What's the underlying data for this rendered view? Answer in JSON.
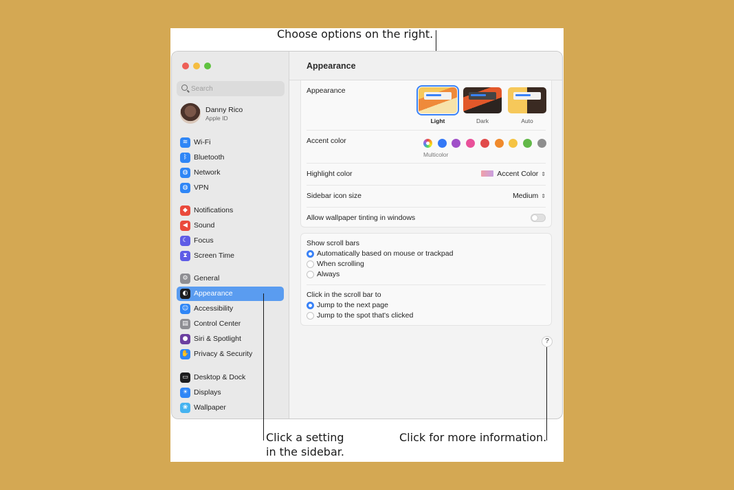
{
  "callouts": {
    "top": "Choose options on the right.",
    "left_line1": "Click a setting",
    "left_line2": "in the sidebar.",
    "right": "Click for more information."
  },
  "sidebar": {
    "search_placeholder": "Search",
    "account": {
      "name": "Danny Rico",
      "subtitle": "Apple ID"
    },
    "items": [
      {
        "label": "Wi-Fi",
        "icon": "wifi-icon",
        "color": "#2f86f6"
      },
      {
        "label": "Bluetooth",
        "icon": "bluetooth-icon",
        "color": "#2f86f6"
      },
      {
        "label": "Network",
        "icon": "globe-icon",
        "color": "#2f86f6"
      },
      {
        "label": "VPN",
        "icon": "vpn-globe-icon",
        "color": "#2f86f6"
      },
      {
        "label": "Notifications",
        "icon": "bell-icon",
        "color": "#ea4a3c"
      },
      {
        "label": "Sound",
        "icon": "speaker-icon",
        "color": "#ea4a3c"
      },
      {
        "label": "Focus",
        "icon": "moon-icon",
        "color": "#5e5ce6"
      },
      {
        "label": "Screen Time",
        "icon": "hourglass-icon",
        "color": "#5e5ce6"
      },
      {
        "label": "General",
        "icon": "gear-icon",
        "color": "#8e8e93"
      },
      {
        "label": "Appearance",
        "icon": "appearance-icon",
        "color": "#1c1c1e",
        "selected": true
      },
      {
        "label": "Accessibility",
        "icon": "accessibility-icon",
        "color": "#2f86f6"
      },
      {
        "label": "Control Center",
        "icon": "control-center-icon",
        "color": "#8e8e93"
      },
      {
        "label": "Siri & Spotlight",
        "icon": "siri-icon",
        "color": "#6b3fa0"
      },
      {
        "label": "Privacy & Security",
        "icon": "hand-icon",
        "color": "#2f86f6"
      },
      {
        "label": "Desktop & Dock",
        "icon": "dock-icon",
        "color": "#1c1c1e"
      },
      {
        "label": "Displays",
        "icon": "sun-icon",
        "color": "#2f86f6"
      },
      {
        "label": "Wallpaper",
        "icon": "flower-icon",
        "color": "#45b3f0"
      }
    ]
  },
  "main": {
    "title": "Appearance",
    "appearance": {
      "label": "Appearance",
      "options": [
        {
          "label": "Light",
          "selected": true
        },
        {
          "label": "Dark",
          "selected": false
        },
        {
          "label": "Auto",
          "selected": false
        }
      ]
    },
    "accent": {
      "label": "Accent color",
      "caption": "Multicolor",
      "colors": [
        "multicolor",
        "#3478f6",
        "#a050c8",
        "#e9519a",
        "#e14b4b",
        "#f08a2c",
        "#f5c342",
        "#62b848",
        "#8e8e8e"
      ]
    },
    "highlight": {
      "label": "Highlight color",
      "value": "Accent Color"
    },
    "sidebar_icon_size": {
      "label": "Sidebar icon size",
      "value": "Medium"
    },
    "wallpaper_tinting": {
      "label": "Allow wallpaper tinting in windows",
      "on": false
    },
    "scroll_bars": {
      "label": "Show scroll bars",
      "options": [
        {
          "label": "Automatically based on mouse or trackpad",
          "selected": true
        },
        {
          "label": "When scrolling",
          "selected": false
        },
        {
          "label": "Always",
          "selected": false
        }
      ]
    },
    "click_scroll": {
      "label": "Click in the scroll bar to",
      "options": [
        {
          "label": "Jump to the next page",
          "selected": true
        },
        {
          "label": "Jump to the spot that's clicked",
          "selected": false
        }
      ]
    },
    "help_label": "?"
  }
}
